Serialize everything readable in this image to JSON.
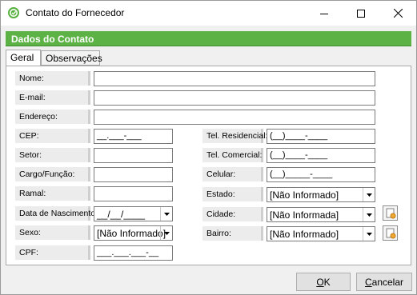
{
  "window": {
    "title": "Contato do Fornecedor",
    "controls": [
      "minimize",
      "maximize",
      "close"
    ]
  },
  "section": {
    "title": "Dados do Contato"
  },
  "tabs": [
    {
      "label": "Geral",
      "active": true
    },
    {
      "label": "Observações",
      "active": false
    }
  ],
  "fields": {
    "nome": {
      "label": "Nome:",
      "value": ""
    },
    "email": {
      "label": "E-mail:",
      "value": ""
    },
    "endereco": {
      "label": "Endereço:",
      "value": ""
    },
    "cep": {
      "label": "CEP:",
      "value": "__.___-___"
    },
    "setor": {
      "label": "Setor:",
      "value": ""
    },
    "cargo": {
      "label": "Cargo/Função:",
      "value": ""
    },
    "ramal": {
      "label": "Ramal:",
      "value": ""
    },
    "nascimento": {
      "label": "Data de Nascimento:",
      "value": "__/__/____"
    },
    "sexo": {
      "label": "Sexo:",
      "value": "[Não Informado]"
    },
    "cpf": {
      "label": "CPF:",
      "value": "___.___.___-__"
    },
    "tel_residencial": {
      "label": "Tel. Residencial:",
      "value": "(__)____-____"
    },
    "tel_comercial": {
      "label": "Tel. Comercial:",
      "value": "(__)____-____"
    },
    "celular": {
      "label": "Celular:",
      "value": "(__)_____-____"
    },
    "estado": {
      "label": "Estado:",
      "value": "[Não Informado]"
    },
    "cidade": {
      "label": "Cidade:",
      "value": "[Não Informada]"
    },
    "bairro": {
      "label": "Bairro:",
      "value": "[Não Informado]"
    }
  },
  "buttons": {
    "ok": {
      "accel": "O",
      "rest": "K"
    },
    "cancel": {
      "accel": "C",
      "rest": "ancelar"
    }
  },
  "colors": {
    "accent": "#5db245",
    "app_icon": "#58b13f"
  }
}
